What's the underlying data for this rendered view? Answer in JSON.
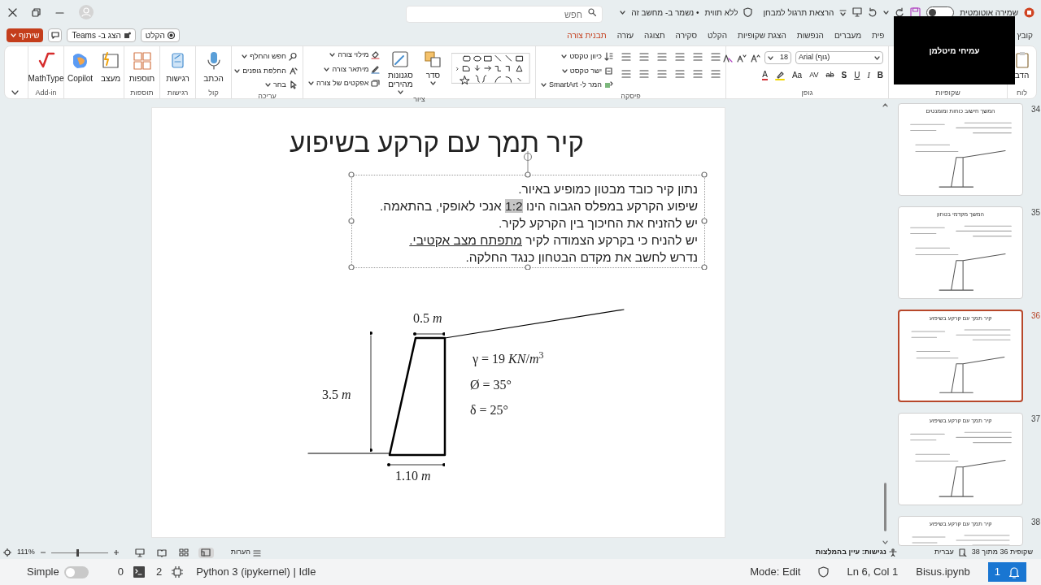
{
  "title_bar": {
    "search_placeholder": "חפש",
    "document_title": "הרצאת תרגול למבחן",
    "label": "ללא תווית",
    "save_status": "• נשמר ב- מחשב זה",
    "autosave_label": "שמירה אוטומטית",
    "autosave_on": false
  },
  "video_overlay": {
    "name": "עמיחי מיטלמן"
  },
  "ribbon_actions": {
    "share": "שיתוף",
    "teams": "הצג ב- Teams",
    "record": "הקלט"
  },
  "ribbon_tabs": [
    {
      "label": "קובץ",
      "kind": "standard"
    },
    {
      "label": "פית",
      "kind": "standard"
    },
    {
      "label": "מעברים",
      "kind": "standard"
    },
    {
      "label": "הנפשות",
      "kind": "standard"
    },
    {
      "label": "הצגת שקופיות",
      "kind": "standard"
    },
    {
      "label": "הקלט",
      "kind": "standard"
    },
    {
      "label": "סקירה",
      "kind": "standard"
    },
    {
      "label": "תצוגה",
      "kind": "standard"
    },
    {
      "label": "עזרה",
      "kind": "standard"
    },
    {
      "label": "תבנית צורה",
      "kind": "contextual"
    }
  ],
  "ribbon_groups": [
    {
      "kind": "clipped",
      "label": "לוח",
      "text": "הדב"
    },
    {
      "kind": "covered",
      "label": "שקופיות"
    },
    {
      "kind": "font",
      "label": "גופן",
      "font_name": "Arial (גוף)",
      "font_size": "18",
      "buttons": [
        "B",
        "I",
        "U",
        "S",
        "ab",
        "AV",
        "Aa",
        "A"
      ]
    },
    {
      "kind": "paragraph",
      "label": "פיסקה",
      "commands": [
        "כיוון טקסט",
        "ישר טקסט",
        "המר ל- SmartArt"
      ]
    },
    {
      "kind": "drawing",
      "label": "ציור",
      "big": [
        "סדר",
        "סגנונות מהירים"
      ],
      "commands": [
        "מילוי צורה",
        "מיתאר צורה",
        "אפקטים של צורה"
      ]
    },
    {
      "kind": "commands",
      "label": "עריכה",
      "commands": [
        "חפש והחלף",
        "החלפת גופנים",
        "בחר"
      ]
    },
    {
      "kind": "big",
      "label": "קול",
      "buttons": [
        "הכתב"
      ]
    },
    {
      "kind": "big",
      "label": "רגישות",
      "buttons": [
        "רגישות"
      ]
    },
    {
      "kind": "big",
      "label": "תוספות",
      "buttons": [
        "תוספות"
      ]
    },
    {
      "kind": "big",
      "buttons": [
        "מעצב",
        "Copilot"
      ]
    },
    {
      "kind": "big",
      "label": "Add-in",
      "buttons": [
        "MathType"
      ]
    }
  ],
  "slide": {
    "title": "קיר תמך עם קרקע בשיפוע",
    "text_lines": [
      [
        {
          "text": "נתון קיר כובד מבטון כמופיע באיור.",
          "kind": "plain"
        }
      ],
      [
        {
          "text": "שיפוע הקרקע במפלס הגבוה הינו ",
          "kind": "plain"
        },
        {
          "text": "1:2",
          "kind": "highlight"
        },
        {
          "text": " אנכי לאופקי, בהתאמה.",
          "kind": "plain"
        }
      ],
      [
        {
          "text": "יש להזניח את החיכוך בין הקרקע לקיר.",
          "kind": "plain"
        }
      ],
      [
        {
          "text": "יש להניח כי בקרקע הצמודה לקיר ",
          "kind": "plain"
        },
        {
          "text": "מתפתח מצב אקטיבי.",
          "kind": "underline"
        }
      ],
      [
        {
          "text": "נדרש לחשב את מקדם הבטחון כנגד החלקה.",
          "kind": "plain"
        }
      ]
    ],
    "diagram": {
      "top_width": "0.5 *m*",
      "height": "3.5 *m*",
      "base_width": "1.10 *m*",
      "properties": [
        "γ = 19 *KN*/*m*$^{3}$",
        "Ø = 35°",
        "δ = 25°"
      ]
    }
  },
  "thumbnails": [
    {
      "number": "34",
      "title": "המשך חישוב כוחות ומומנטים",
      "selected": false
    },
    {
      "number": "35",
      "title": "המשך מקדמי בטחון",
      "selected": false
    },
    {
      "number": "36",
      "title": "קיר תמך עם קרקע בשיפוע",
      "selected": true
    },
    {
      "number": "37",
      "title": "קיר תמך עם קרקע בשיפוע",
      "selected": false
    },
    {
      "number": "38",
      "title": "קיר תמך עם קרקע בשיפוע",
      "selected": false
    }
  ],
  "status_bar": {
    "slide_position": "שקופית 36 מתוך 38",
    "language": "עברית",
    "accessibility": "נגישות: עיין בהמלצות",
    "notes": "הערות",
    "views": [
      {
        "selected": true
      },
      {
        "selected": false
      },
      {
        "selected": false
      },
      {
        "selected": false
      }
    ],
    "zoom": "111%",
    "zoom_slider": {
      "level": 0.47
    }
  },
  "editor_status_bar": {
    "mode_label": "Simple",
    "simple_on": false,
    "terminals": "0",
    "kernels": "2",
    "kernel_status": "Python 3 (ipykernel) | Idle",
    "mode": "Mode: Edit",
    "position": "Ln 6, Col 1",
    "file": "Bisus.ipynb",
    "notifications": "1"
  }
}
